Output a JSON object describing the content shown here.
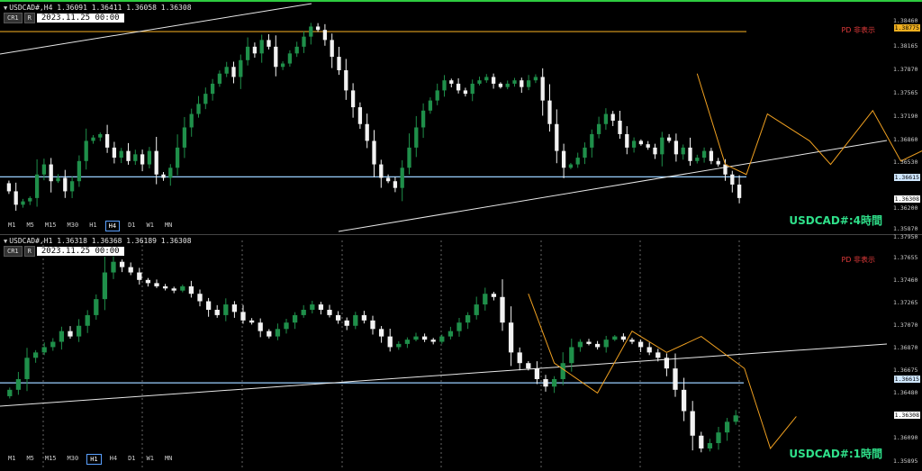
{
  "h4": {
    "header": "USDCAD#,H4  1.36091 1.36411 1.36058 1.36308",
    "btn_cr": "CR1",
    "btn_r": "R",
    "date_value": "2023.11.25 00:00",
    "timeframes": [
      "M1",
      "M5",
      "M15",
      "M30",
      "H1",
      "H4",
      "D1",
      "W1",
      "MN"
    ],
    "selected_tf": "H4",
    "title": "USDCAD#:4時間",
    "pd_label": "PD 非表示",
    "price_ticks": [
      "1.38460",
      "1.38165",
      "1.37870",
      "1.37565",
      "1.37190",
      "1.36860",
      "1.36530",
      "1.36200",
      "1.35870"
    ],
    "tag_orange": "1.38775",
    "tag_blue": "1.36615",
    "tag_price": "1.36308"
  },
  "h1": {
    "header": "USDCAD#,H1  1.36318 1.36368 1.36189 1.36308",
    "btn_cr": "CR1",
    "btn_r": "R",
    "date_value": "2023.11.25 00:00",
    "timeframes": [
      "M1",
      "M5",
      "M15",
      "M30",
      "H1",
      "H4",
      "D1",
      "W1",
      "MN"
    ],
    "selected_tf": "H1",
    "title": "USDCAD#:1時間",
    "pd_label": "PD 非表示",
    "price_ticks": [
      "1.37950",
      "1.37655",
      "1.37460",
      "1.37265",
      "1.37070",
      "1.36870",
      "1.36675",
      "1.36480",
      "1.36285",
      "1.36090",
      "1.35895"
    ],
    "tag_blue": "1.36615",
    "tag_price": "1.36308"
  },
  "colors": {
    "bull": "#1f8f4a",
    "bear": "#f2f2f2",
    "zigzag": "#f0a020",
    "hline_blue": "#9ad0ff",
    "hline_orange": "#e0a020",
    "trend": "#e8e8e8",
    "title": "#2fe08a",
    "pd": "#e23b3b"
  },
  "chart_data": [
    {
      "type": "candlestick",
      "timeframe": "H4",
      "symbol": "USDCAD#",
      "ylim": [
        1.3587,
        1.3895
      ],
      "horizontal_levels": [
        1.38775,
        1.36615
      ],
      "last_price": 1.36308,
      "close_path": [
        1.364,
        1.362,
        1.3625,
        1.363,
        1.3665,
        1.368,
        1.3655,
        1.366,
        1.364,
        1.3655,
        1.3685,
        1.3715,
        1.372,
        1.3725,
        1.3705,
        1.369,
        1.37,
        1.3685,
        1.3695,
        1.368,
        1.37,
        1.3665,
        1.366,
        1.3675,
        1.3705,
        1.3735,
        1.3755,
        1.377,
        1.3785,
        1.38,
        1.3815,
        1.3825,
        1.381,
        1.3835,
        1.3855,
        1.3845,
        1.3865,
        1.3855,
        1.3825,
        1.383,
        1.3845,
        1.3855,
        1.387,
        1.3885,
        1.388,
        1.3865,
        1.384,
        1.382,
        1.379,
        1.3765,
        1.374,
        1.3715,
        1.368,
        1.366,
        1.3655,
        1.3645,
        1.3675,
        1.3705,
        1.3735,
        1.376,
        1.3775,
        1.379,
        1.3805,
        1.38,
        1.379,
        1.3785,
        1.38,
        1.3805,
        1.381,
        1.38,
        1.3795,
        1.38,
        1.3805,
        1.3795,
        1.3805,
        1.381,
        1.3775,
        1.374,
        1.37,
        1.3675,
        1.368,
        1.369,
        1.3705,
        1.3725,
        1.374,
        1.3755,
        1.3745,
        1.3725,
        1.3705,
        1.3715,
        1.371,
        1.3705,
        1.3695,
        1.372,
        1.3715,
        1.3695,
        1.3705,
        1.3685,
        1.369,
        1.37,
        1.3685,
        1.368,
        1.3665,
        1.365,
        1.363
      ]
    },
    {
      "type": "candlestick",
      "timeframe": "H1",
      "symbol": "USDCAD#",
      "ylim": [
        1.3589,
        1.3795
      ],
      "horizontal_levels": [
        1.36615
      ],
      "last_price": 1.36308,
      "close_path": [
        1.3655,
        1.3665,
        1.3685,
        1.369,
        1.3695,
        1.37,
        1.371,
        1.3705,
        1.3715,
        1.3725,
        1.374,
        1.3765,
        1.3775,
        1.377,
        1.3765,
        1.3758,
        1.3755,
        1.3752,
        1.375,
        1.3748,
        1.3752,
        1.3745,
        1.3738,
        1.373,
        1.3725,
        1.3735,
        1.3728,
        1.372,
        1.3718,
        1.371,
        1.3705,
        1.3712,
        1.3718,
        1.3725,
        1.373,
        1.3735,
        1.373,
        1.3725,
        1.372,
        1.3715,
        1.3725,
        1.372,
        1.3712,
        1.3705,
        1.3695,
        1.3698,
        1.3702,
        1.3705,
        1.3702,
        1.37,
        1.3705,
        1.371,
        1.3718,
        1.3725,
        1.3735,
        1.3745,
        1.3742,
        1.3718,
        1.369,
        1.368,
        1.3675,
        1.3665,
        1.3658,
        1.3665,
        1.368,
        1.3695,
        1.37,
        1.3698,
        1.3695,
        1.3702,
        1.3705,
        1.3702,
        1.37,
        1.3695,
        1.369,
        1.3685,
        1.3675,
        1.3655,
        1.3635,
        1.3612,
        1.36,
        1.3605,
        1.3615,
        1.3625,
        1.3631
      ]
    }
  ]
}
